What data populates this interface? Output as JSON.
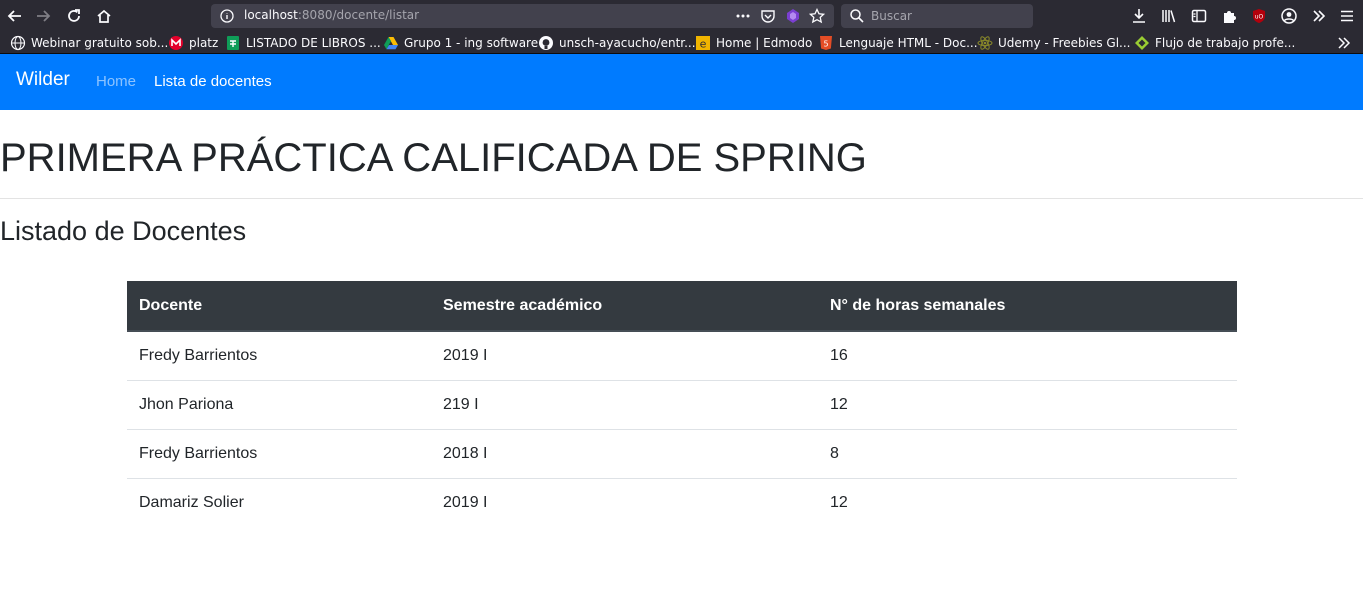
{
  "browser": {
    "url_host": "localhost",
    "url_path": ":8080/docente/listar",
    "search_placeholder": "Buscar",
    "bookmarks": [
      {
        "label": "Webinar gratuito sob...",
        "icon": "globe-icon"
      },
      {
        "label": "platz",
        "icon": "platzi-icon"
      },
      {
        "label": "LISTADO DE LIBROS ...",
        "icon": "sheets-icon"
      },
      {
        "label": "Grupo 1 - ing software",
        "icon": "drive-icon"
      },
      {
        "label": "unsch-ayacucho/entr...",
        "icon": "github-icon"
      },
      {
        "label": "Home | Edmodo",
        "icon": "edmodo-icon"
      },
      {
        "label": "Lenguaje HTML - Doc...",
        "icon": "html5-icon"
      },
      {
        "label": "Udemy - Freebies Gl...",
        "icon": "react-icon"
      },
      {
        "label": "Flujo de trabajo profe...",
        "icon": "gitkraken-icon"
      }
    ]
  },
  "navbar": {
    "brand": "Wilder",
    "links": [
      "Home",
      "Lista de docentes"
    ]
  },
  "page": {
    "title": "PRIMERA PRÁCTICA CALIFICADA DE SPRING",
    "subtitle": "Listado de Docentes"
  },
  "table": {
    "headers": [
      "Docente",
      "Semestre académico",
      "N° de horas semanales"
    ],
    "rows": [
      [
        "Fredy Barrientos",
        "2019 I",
        "16"
      ],
      [
        "Jhon Pariona",
        "219 I",
        "12"
      ],
      [
        "Fredy Barrientos",
        "2018 I",
        "8"
      ],
      [
        "Damariz Solier",
        "2019 I",
        "12"
      ]
    ]
  },
  "colors": {
    "navbar": "#007bff",
    "table_header": "#343a40",
    "browser_chrome": "#2b2a33"
  }
}
